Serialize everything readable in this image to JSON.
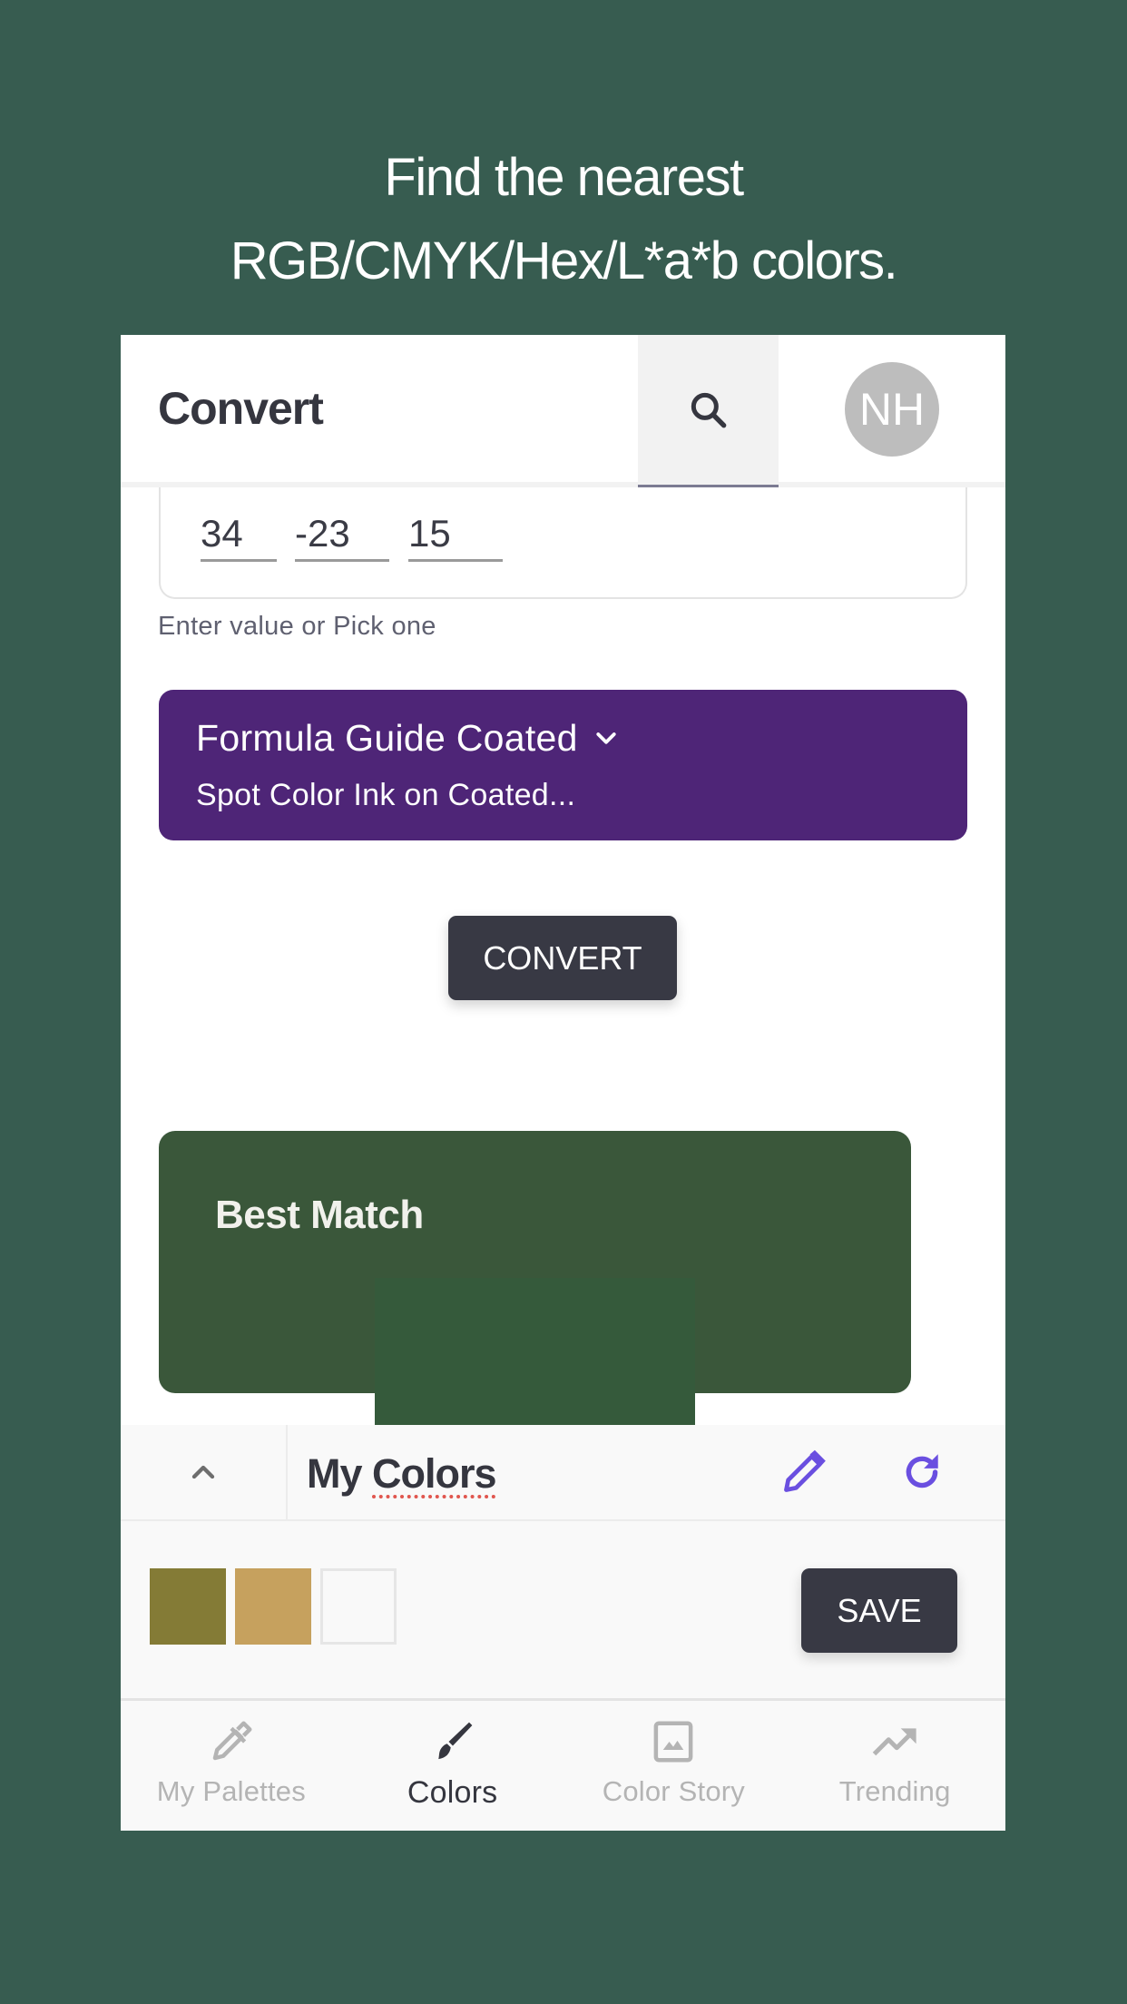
{
  "headline": {
    "line1": "Find the nearest",
    "line2": "RGB/CMYK/Hex/L*a*b colors."
  },
  "header": {
    "title": "Convert",
    "search_icon": "search-icon",
    "avatar_initials": "NH"
  },
  "input": {
    "values": [
      "34",
      "-23",
      "15"
    ],
    "helper": "Enter value or Pick one"
  },
  "guide_select": {
    "name": "Formula Guide Coated",
    "description": "Spot Color Ink on Coated...",
    "icon": "chevron-down-icon",
    "color": "#4e2577"
  },
  "convert_button": "CONVERT",
  "best_match": {
    "title": "Best Match",
    "card_color": "#3a573a",
    "swatch_color": "#355a3b"
  },
  "my_colors": {
    "title_prefix": "My ",
    "title_word": "Colors",
    "collapse_icon": "chevron-up-icon",
    "edit_icon": "pencil-icon",
    "refresh_icon": "refresh-icon",
    "accent": "#6a4fe0",
    "swatches": [
      "#847b36",
      "#c6a15e",
      "#f9f9f9"
    ],
    "save_label": "SAVE"
  },
  "bottom_nav": {
    "items": [
      {
        "label": "My Palettes",
        "icon": "eyedropper-icon",
        "active": false
      },
      {
        "label": "Colors",
        "icon": "paintbrush-icon",
        "active": true
      },
      {
        "label": "Color Story",
        "icon": "image-icon",
        "active": false
      },
      {
        "label": "Trending",
        "icon": "trending-up-icon",
        "active": false
      }
    ]
  }
}
